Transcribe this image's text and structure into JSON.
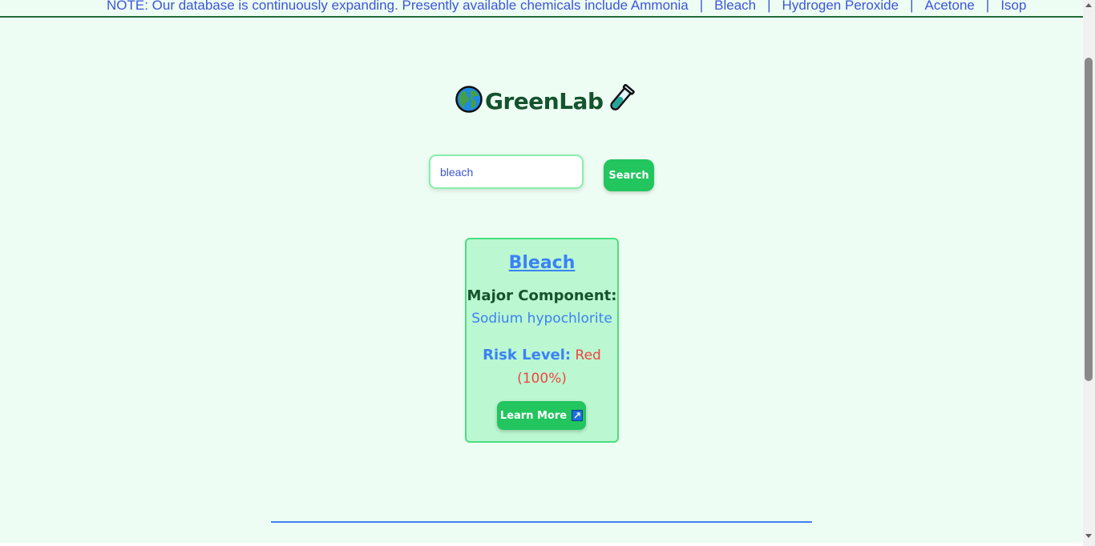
{
  "banner": {
    "note": "NOTE: Our database is continuously expanding. Presently available chemicals include Ammonia",
    "chemicals": [
      "Bleach",
      "Hydrogen Peroxide",
      "Acetone",
      "Isop"
    ],
    "separator": "|"
  },
  "logo": {
    "title": "GreenLab",
    "left_icon": "globe-icon",
    "right_icon": "test-tube-icon"
  },
  "search": {
    "value": "bleach",
    "button_label": "Search"
  },
  "result": {
    "name": "Bleach",
    "component_label": "Major Component:",
    "component_value": "Sodium hypochlorite",
    "risk_label": "Risk Level:",
    "risk_value": "Red (100%)",
    "learn_more_label": "Learn More",
    "learn_more_icon": "external-link-icon"
  },
  "colors": {
    "accent": "#22c55e",
    "link": "#3b82f6",
    "heading": "#14532d",
    "risk": "#ef4444",
    "card_bg": "#bbf7d0",
    "page_bg": "#eefdf3"
  }
}
